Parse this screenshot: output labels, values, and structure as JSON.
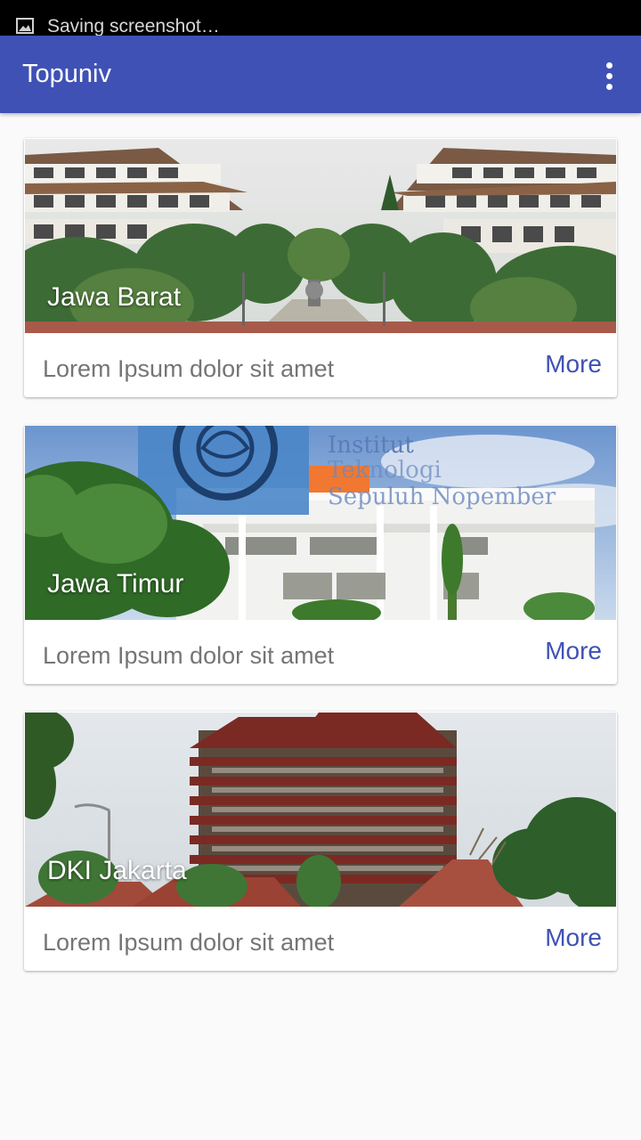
{
  "status_bar": {
    "notification_text": "Saving screenshot…",
    "notification_icon": "image-icon"
  },
  "app_bar": {
    "title": "Topuniv",
    "menu_icon": "more-vertical-icon",
    "color": "#3f51b5"
  },
  "cards": [
    {
      "title": "Jawa Barat",
      "description": "Lorem Ipsum dolor sit amet",
      "action": "More"
    },
    {
      "title": "Jawa Timur",
      "description": "Lorem Ipsum dolor sit amet",
      "action": "More"
    },
    {
      "title": "DKI Jakarta",
      "description": "Lorem Ipsum dolor sit amet",
      "action": "More"
    }
  ],
  "photo_overlay": {
    "line1": "Institut",
    "line2": "Teknologi",
    "line3": "Sepuluh Nopember"
  }
}
